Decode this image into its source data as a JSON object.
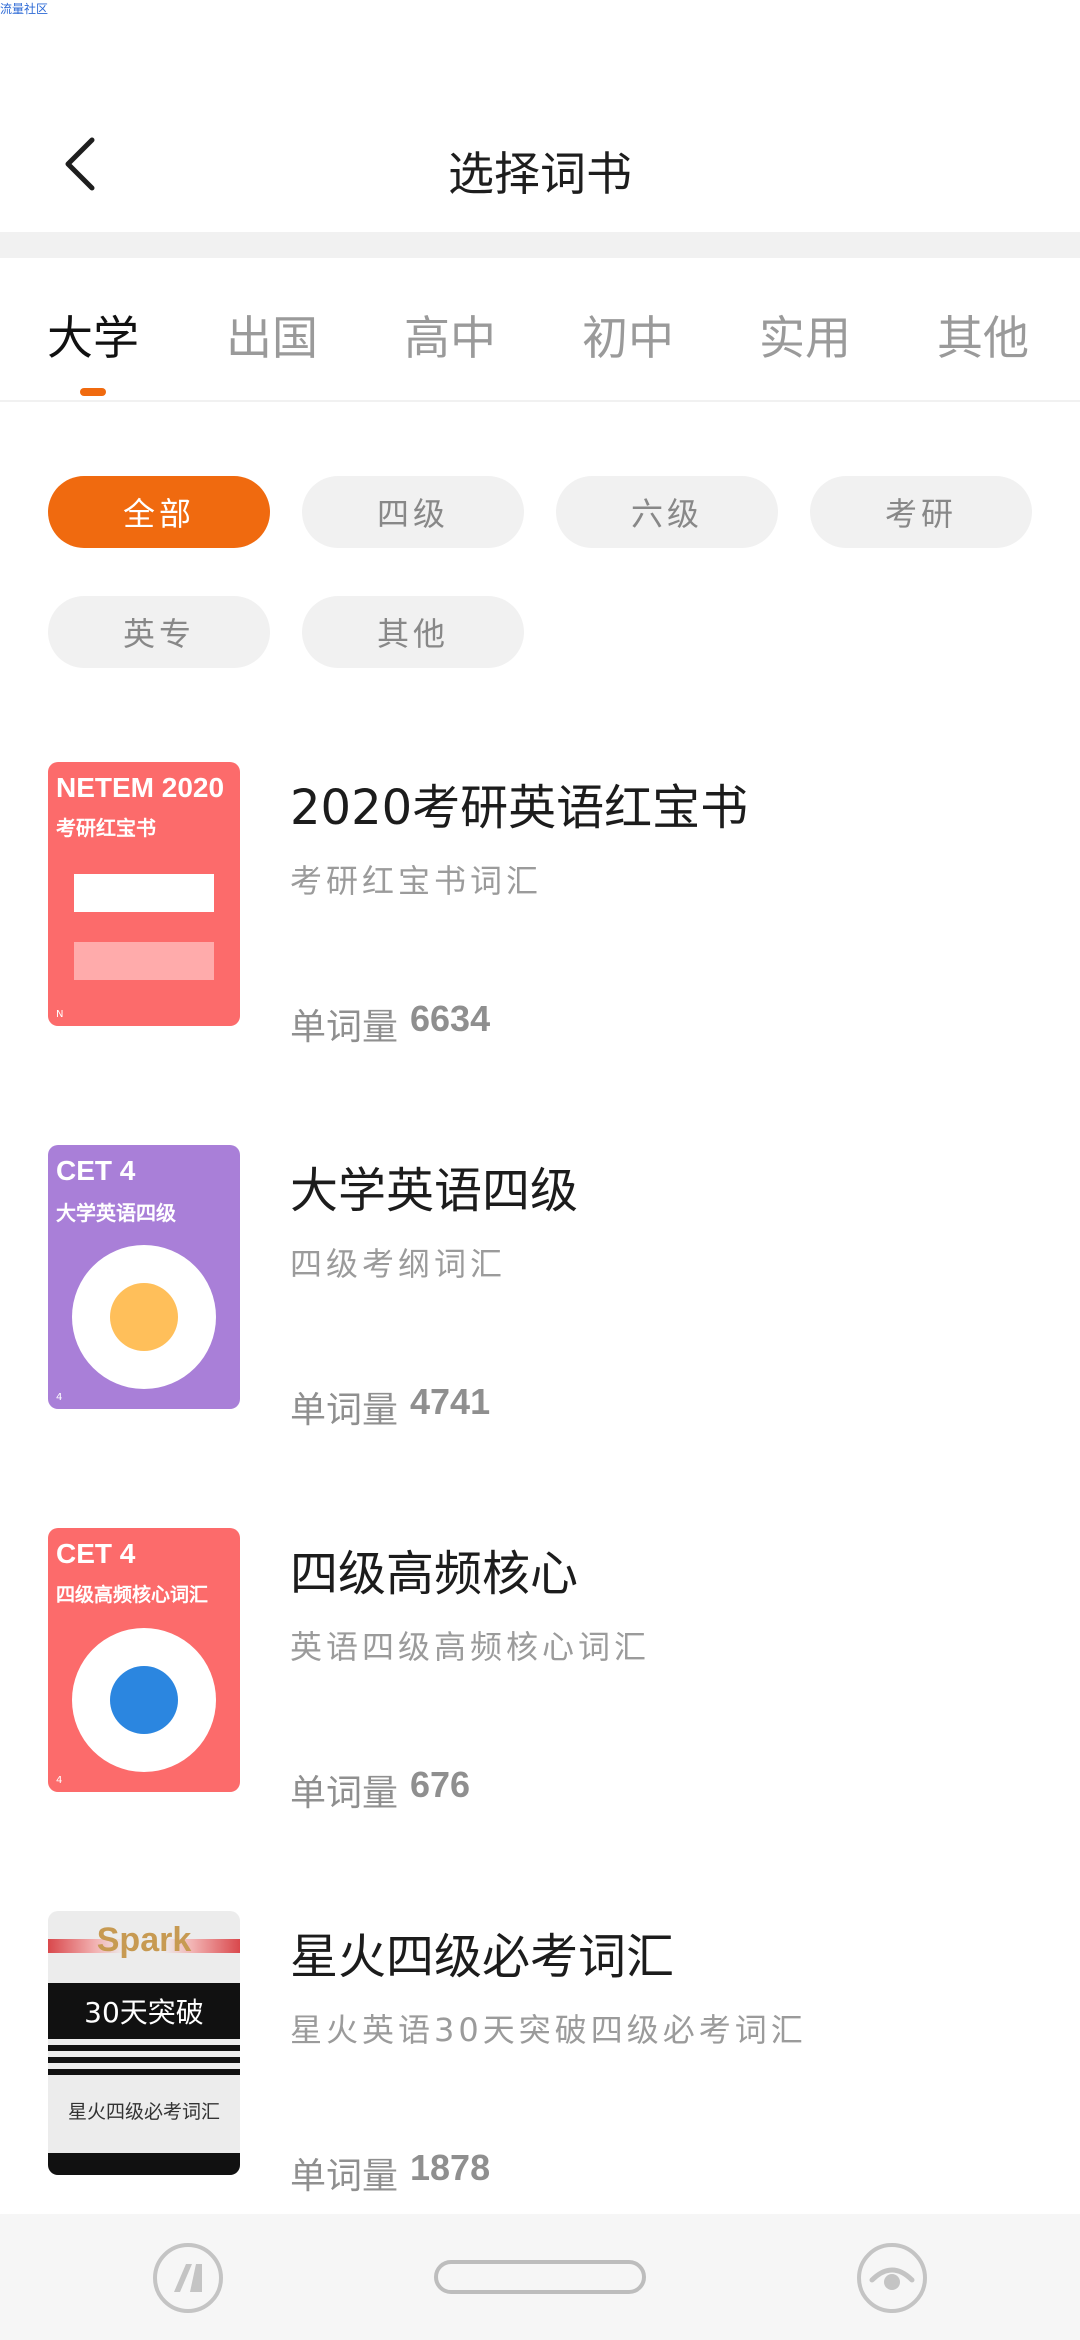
{
  "watermark": "流量社区",
  "header": {
    "title": "选择词书",
    "back": "chevron-left-icon"
  },
  "tabs": [
    {
      "label": "大学",
      "active": true
    },
    {
      "label": "出国",
      "active": false
    },
    {
      "label": "高中",
      "active": false
    },
    {
      "label": "初中",
      "active": false
    },
    {
      "label": "实用",
      "active": false
    },
    {
      "label": "其他",
      "active": false
    }
  ],
  "filters": [
    {
      "label": "全部",
      "active": true
    },
    {
      "label": "四级",
      "active": false
    },
    {
      "label": "六级",
      "active": false
    },
    {
      "label": "考研",
      "active": false
    },
    {
      "label": "英专",
      "active": false
    },
    {
      "label": "其他",
      "active": false
    }
  ],
  "books": [
    {
      "name": "2020考研英语红宝书",
      "description": "考研红宝书词汇",
      "count_label": "单词量",
      "count": "6634",
      "cover": {
        "title": "NETEM 2020",
        "subtitle": "考研红宝书",
        "corner": "N",
        "color": "#fc6b6b"
      }
    },
    {
      "name": "大学英语四级",
      "description": "四级考纲词汇",
      "count_label": "单词量",
      "count": "4741",
      "cover": {
        "title": "CET 4",
        "subtitle": "大学英语四级",
        "corner": "4",
        "color": "#a97fd8",
        "dot_color": "#ffbf5a"
      }
    },
    {
      "name": "四级高频核心",
      "description": "英语四级高频核心词汇",
      "count_label": "单词量",
      "count": "676",
      "cover": {
        "title": "CET 4",
        "subtitle": "四级高频核心词汇",
        "corner": "4",
        "color": "#fc6b6b",
        "dot_color": "#2b86e0"
      }
    },
    {
      "name": "星火四级必考词汇",
      "description": "星火英语30天突破四级必考词汇",
      "count_label": "单词量",
      "count": "1878",
      "cover": {
        "title": "Spark",
        "subtitle": "30天突破",
        "footer": "星火四级必考词汇"
      }
    }
  ],
  "navbar": {
    "left": "app-switch-icon",
    "center": "home-pill",
    "right": "eye-icon"
  },
  "colors": {
    "accent": "#f06a0f",
    "chip_bg": "#f1f1f1",
    "muted_text": "#9b9b9b"
  }
}
